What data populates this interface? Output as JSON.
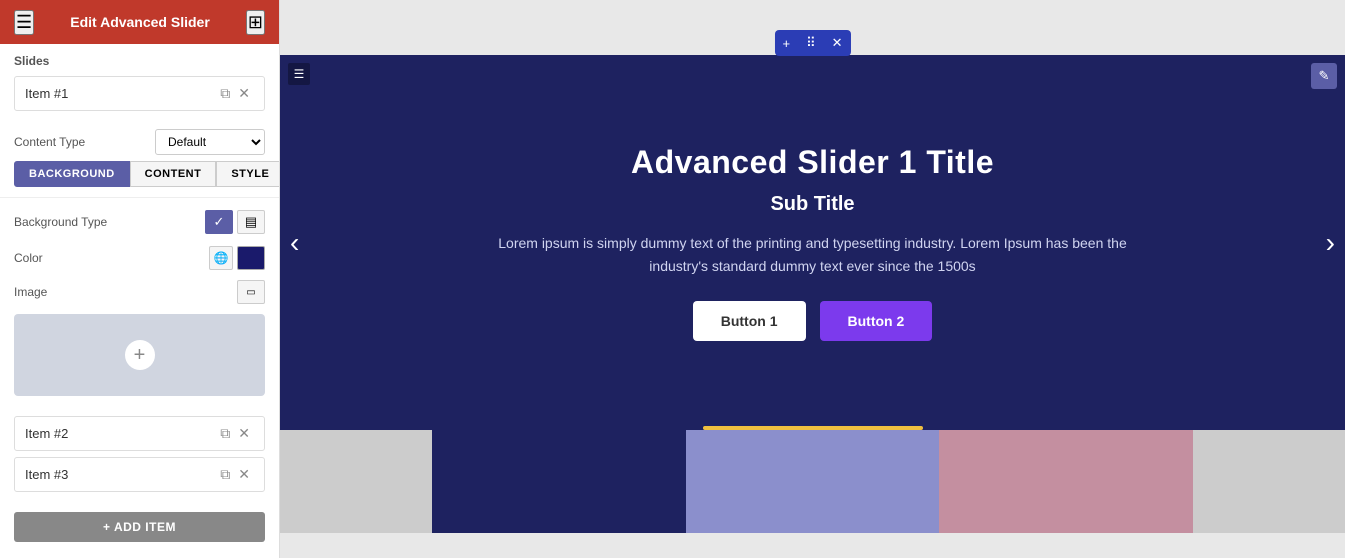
{
  "header": {
    "title": "Edit Advanced Slider",
    "hamburger_icon": "☰",
    "grid_icon": "⊞"
  },
  "slides_section": {
    "label": "Slides",
    "items": [
      {
        "label": "Item #1"
      },
      {
        "label": "Item #2"
      },
      {
        "label": "Item #3"
      }
    ]
  },
  "content_type": {
    "label": "Content Type",
    "value": "Default"
  },
  "tabs": [
    {
      "label": "BACKGROUND",
      "active": true
    },
    {
      "label": "CONTENT",
      "active": false
    },
    {
      "label": "STYLE",
      "active": false
    }
  ],
  "background_type": {
    "label": "Background Type"
  },
  "color": {
    "label": "Color"
  },
  "image": {
    "label": "Image"
  },
  "add_item": {
    "label": "+ ADD ITEM"
  },
  "slider": {
    "title": "Advanced Slider 1 Title",
    "subtitle": "Sub Title",
    "body": "Lorem ipsum is simply dummy text of the printing and typesetting industry. Lorem Ipsum has been the industry's standard dummy text ever since the 1500s",
    "btn1_label": "Button 1",
    "btn2_label": "Button 2"
  },
  "widget_toolbar": {
    "plus_icon": "+",
    "move_icon": "⠿",
    "close_icon": "✕"
  }
}
